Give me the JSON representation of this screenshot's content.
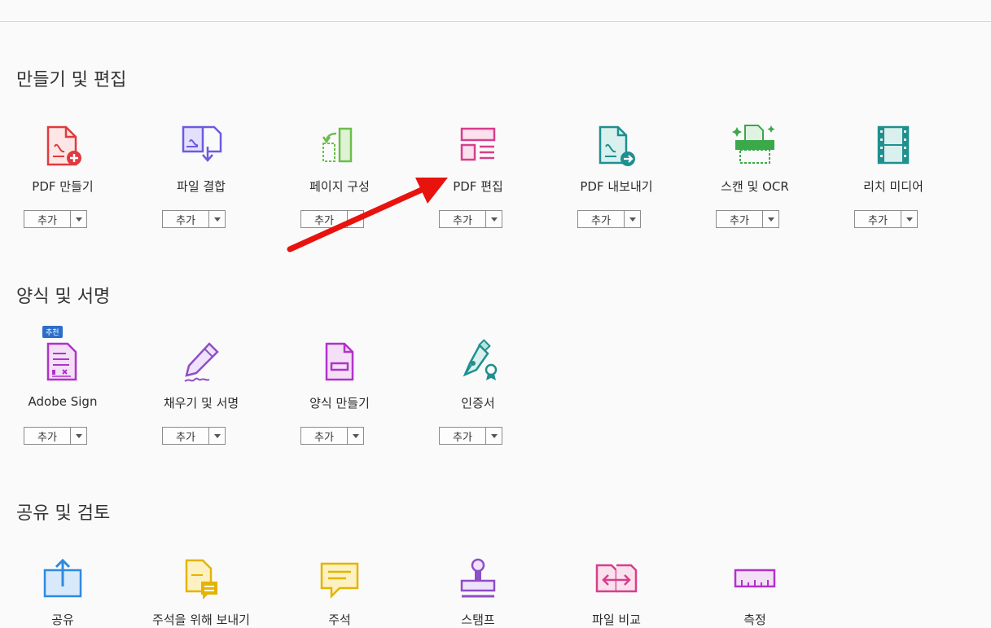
{
  "sections": {
    "create_edit": "만들기 및 편집",
    "forms_sign": "양식 및 서명",
    "share_review": "공유 및 검토"
  },
  "add_label": "추가",
  "badge_recommended": "추천",
  "tools": {
    "create_pdf": "PDF 만들기",
    "combine": "파일 결합",
    "organize": "페이지 구성",
    "edit_pdf": "PDF 편집",
    "export_pdf": "PDF 내보내기",
    "scan_ocr": "스캔 및 OCR",
    "rich_media": "리치 미디어",
    "adobe_sign": "Adobe Sign",
    "fill_sign": "채우기 및 서명",
    "prepare_form": "양식 만들기",
    "certificates": "인증서",
    "share": "공유",
    "send_comments": "주석을 위해 보내기",
    "comment": "주석",
    "stamp": "스탬프",
    "compare": "파일 비교",
    "measure": "측정"
  },
  "colors": {
    "red": "#e03a3e",
    "purple": "#6b5be0",
    "green": "#6abf4b",
    "pink": "#d63f8c",
    "teal": "#1f8f8f",
    "scan_green": "#3ba84a",
    "magenta": "#b033c8",
    "blue": "#2e8ae0",
    "yellow": "#e3b400",
    "annotation_red": "#e8120e"
  }
}
